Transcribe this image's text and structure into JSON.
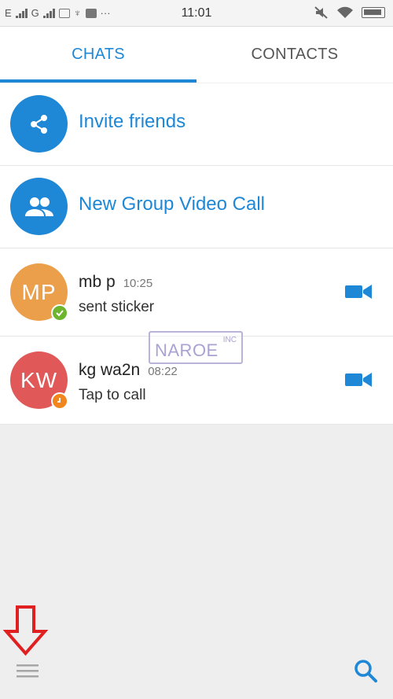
{
  "status_bar": {
    "carrier1": "E",
    "carrier2": "G",
    "dots": "···",
    "time": "11:01"
  },
  "tabs": [
    {
      "label": "CHATS",
      "active": true
    },
    {
      "label": "CONTACTS",
      "active": false
    }
  ],
  "actions": [
    {
      "label": "Invite friends",
      "icon": "share-icon"
    },
    {
      "label": "New Group Video Call",
      "icon": "group-icon"
    }
  ],
  "chats": [
    {
      "initials": "MP",
      "name": "mb p",
      "time": "10:25",
      "subtitle": "sent sticker",
      "avatar_color": "#eb9f4a",
      "status": "online",
      "status_color": "#6cb52d"
    },
    {
      "initials": "KW",
      "name": "kg wa2n",
      "time": "08:22",
      "subtitle": "Tap to call",
      "avatar_color": "#e05858",
      "status": "away",
      "status_color": "#f0861d"
    }
  ],
  "watermark": {
    "text": "NAROE",
    "sup": "INC"
  },
  "colors": {
    "accent": "#1e87d6",
    "annotation_arrow": "#e02020",
    "background": "#eeeeef"
  }
}
